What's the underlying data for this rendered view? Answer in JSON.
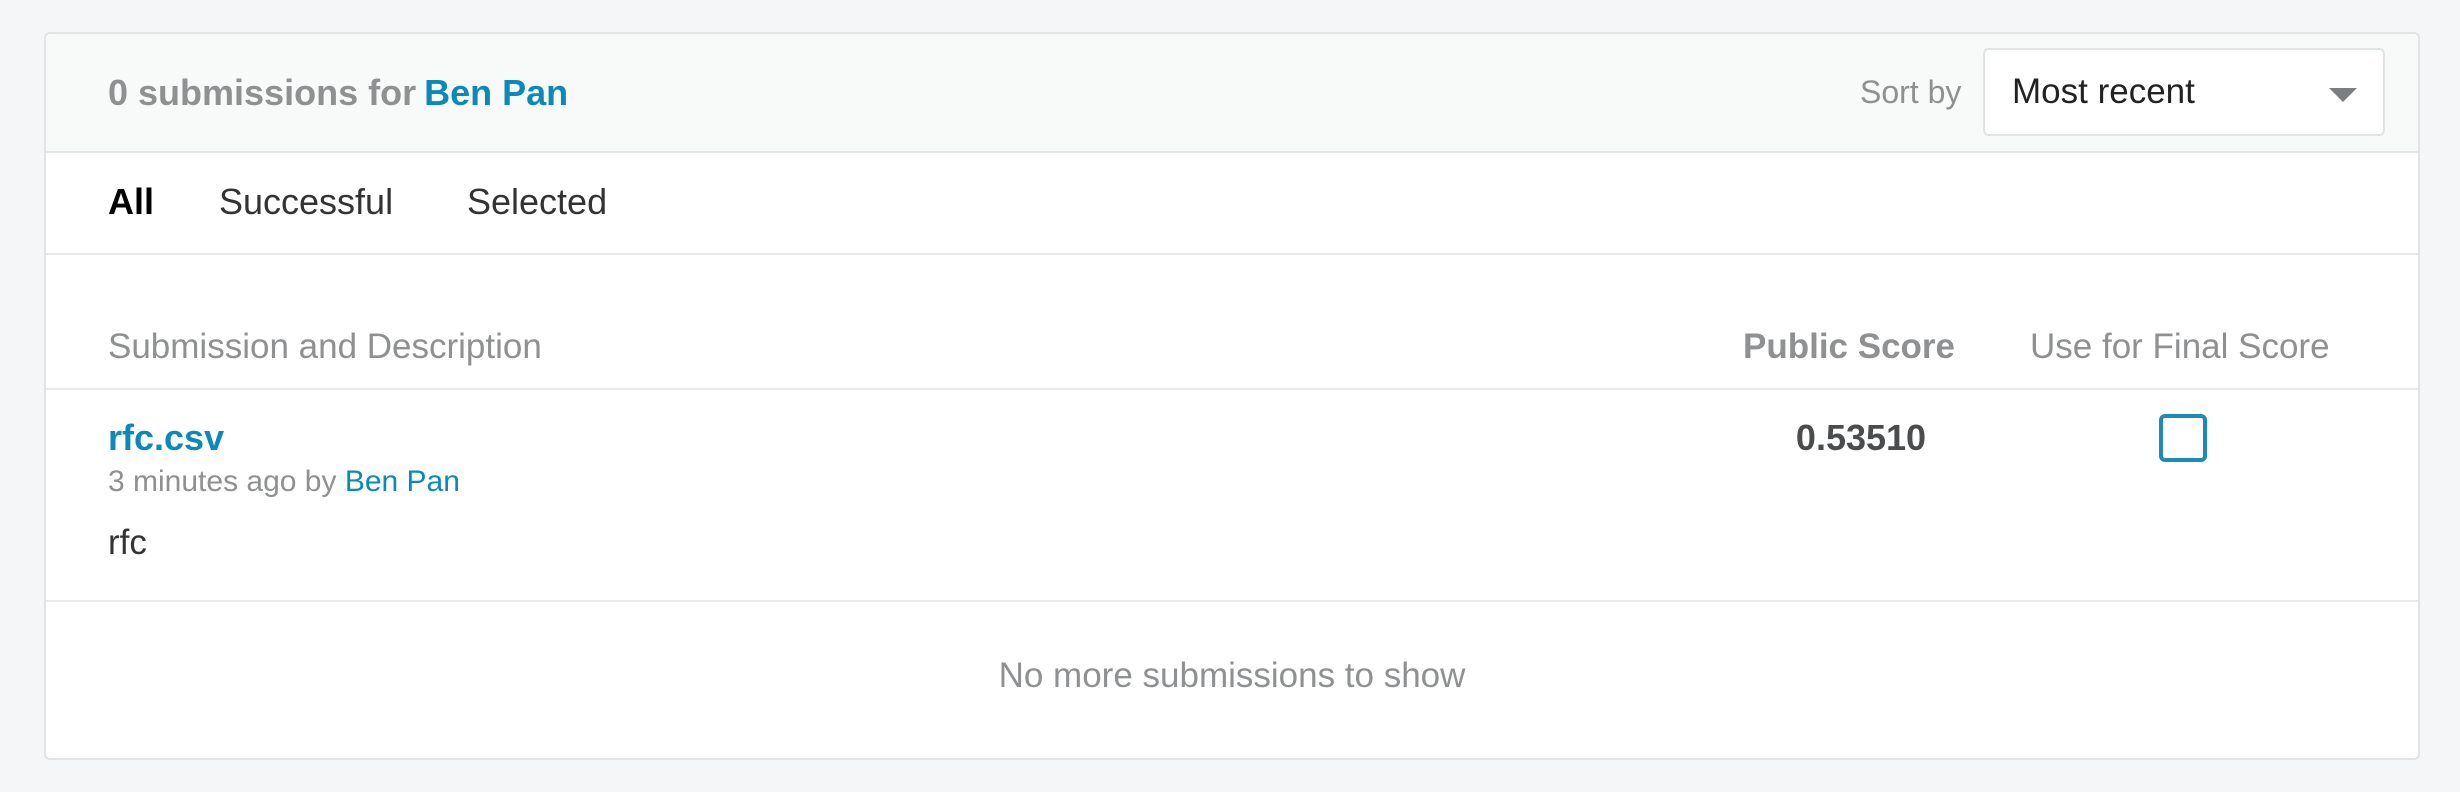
{
  "header": {
    "count_text": "0 submissions for",
    "user_name": "Ben Pan",
    "sort_label": "Sort by",
    "sort_value": "Most recent"
  },
  "tabs": [
    {
      "label": "All",
      "active": true
    },
    {
      "label": "Successful",
      "active": false
    },
    {
      "label": "Selected",
      "active": false
    }
  ],
  "columns": {
    "submission": "Submission and Description",
    "public_score": "Public Score",
    "final_score": "Use for Final Score"
  },
  "submissions": [
    {
      "file": "rfc.csv",
      "time": "3 minutes ago by",
      "user": "Ben Pan",
      "description": "rfc",
      "public_score": "0.53510",
      "use_for_final": false
    }
  ],
  "footer_text": "No more submissions to show",
  "colors": {
    "link": "#0b8ab9",
    "muted": "#8e9091",
    "checkbox_border": "#1c8bb8"
  }
}
